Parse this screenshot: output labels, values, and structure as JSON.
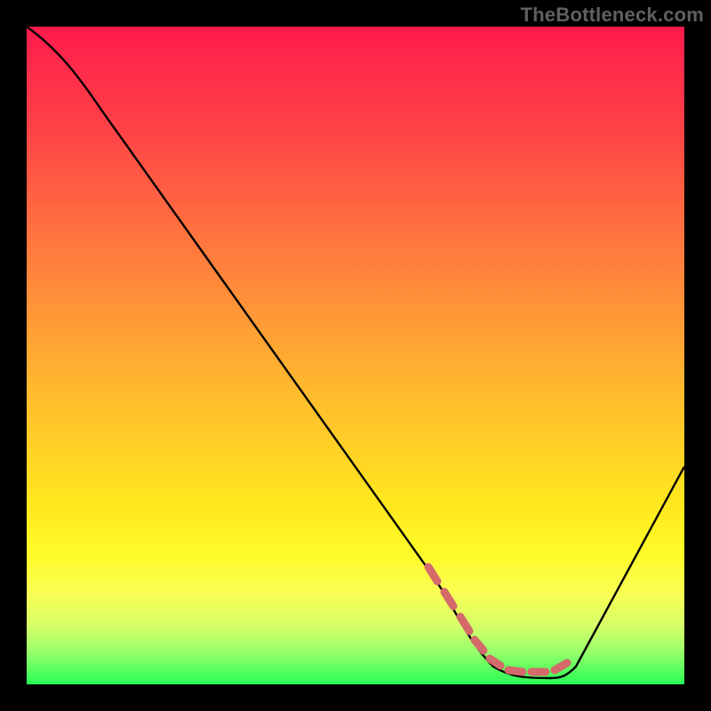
{
  "watermark": "TheBottleneck.com",
  "chart_data": {
    "type": "line",
    "title": "",
    "xlabel": "",
    "ylabel": "",
    "xlim": [
      0,
      100
    ],
    "ylim": [
      0,
      100
    ],
    "background_gradient": {
      "top": "#ff1a4d",
      "bottom": "#28ff55",
      "stops": [
        {
          "pos": 0.0,
          "color": "#ff1a4d"
        },
        {
          "pos": 0.35,
          "color": "#ff9b36"
        },
        {
          "pos": 0.7,
          "color": "#ffe81e"
        },
        {
          "pos": 1.0,
          "color": "#28ff55"
        }
      ]
    },
    "series": [
      {
        "name": "bottleneck-curve",
        "color": "#000000",
        "x": [
          0,
          5,
          10,
          15,
          20,
          25,
          30,
          35,
          40,
          45,
          50,
          55,
          60,
          62,
          65,
          70,
          75,
          80,
          82,
          85,
          90,
          95,
          100
        ],
        "y": [
          100,
          97,
          93,
          87,
          80,
          73,
          66,
          59,
          52,
          45,
          38,
          30,
          21,
          17,
          10,
          4,
          1.5,
          1.5,
          2.5,
          6,
          15,
          24,
          34
        ]
      },
      {
        "name": "optimal-band-marker",
        "color": "#d46a6a",
        "type": "scatter",
        "x": [
          62,
          65,
          68,
          71,
          74,
          77,
          80,
          82
        ],
        "y": [
          17,
          9,
          5,
          3,
          2.5,
          2.5,
          2.5,
          2.5
        ]
      }
    ],
    "annotations": []
  }
}
